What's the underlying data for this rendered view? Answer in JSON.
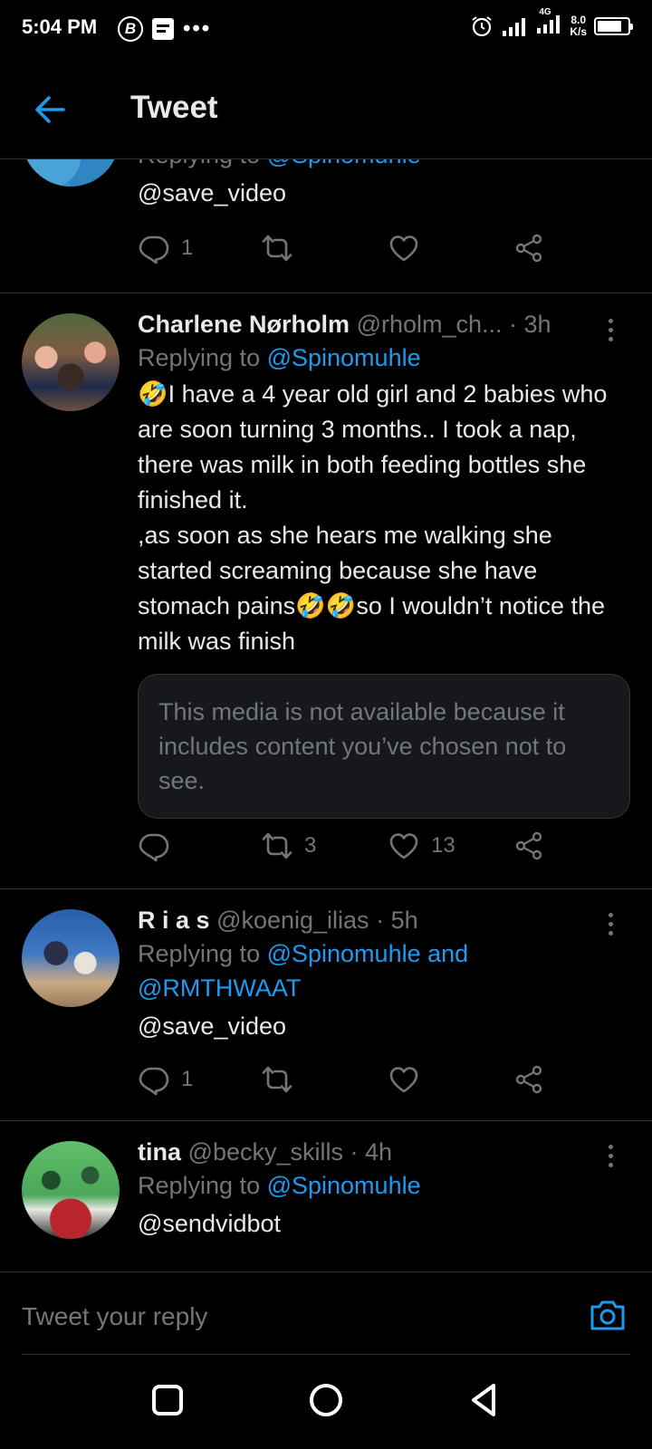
{
  "status_bar": {
    "time": "5:04 PM",
    "net_speed_value": "8.0",
    "net_speed_unit": "K/s",
    "network_type": "4G"
  },
  "header": {
    "title": "Tweet"
  },
  "tweets": [
    {
      "replying_prefix": "Replying to ",
      "replying_to": "@Spinomuhle",
      "text_link": "@save_video",
      "reply_count": "1",
      "retweet_count": "",
      "like_count": ""
    },
    {
      "name": "Charlene Nørholm",
      "handle": "@rholm_ch...",
      "time": " · 3h",
      "replying_prefix": "Replying to ",
      "replying_to": "@Spinomuhle",
      "emoji": "🤣",
      "text_1": "I have a 4 year old girl and 2 babies who are soon turning 3 months.. I took a nap, there was milk in both feeding bottles she finished it.",
      "text_2": ",as soon as she hears me walking she started screaming because she have stomach pains",
      "emoji_double": "🤣🤣",
      "text_3": "so I wouldn’t notice the milk was finish",
      "media_notice": "This media is not available because it includes content you’ve chosen not to see.",
      "reply_count": "",
      "retweet_count": "3",
      "like_count": "13"
    },
    {
      "name": "R i a s",
      "handle": "@koenig_ilias",
      "time": " · 5h",
      "replying_prefix": "Replying to ",
      "replying_to": "@Spinomuhle and",
      "replying_to_2": "@RMTHWAAT",
      "text_link": "@save_video",
      "reply_count": "1",
      "retweet_count": "",
      "like_count": ""
    },
    {
      "name": "tina",
      "handle": "@becky_skills",
      "time": " · 4h",
      "replying_prefix": "Replying to ",
      "replying_to": "@Spinomuhle",
      "text_link": "@sendvidbot"
    }
  ],
  "reply_bar": {
    "placeholder": "Tweet your reply"
  },
  "colors": {
    "accent": "#1d9bf0",
    "muted": "#71767b",
    "divider": "#2f3336"
  }
}
